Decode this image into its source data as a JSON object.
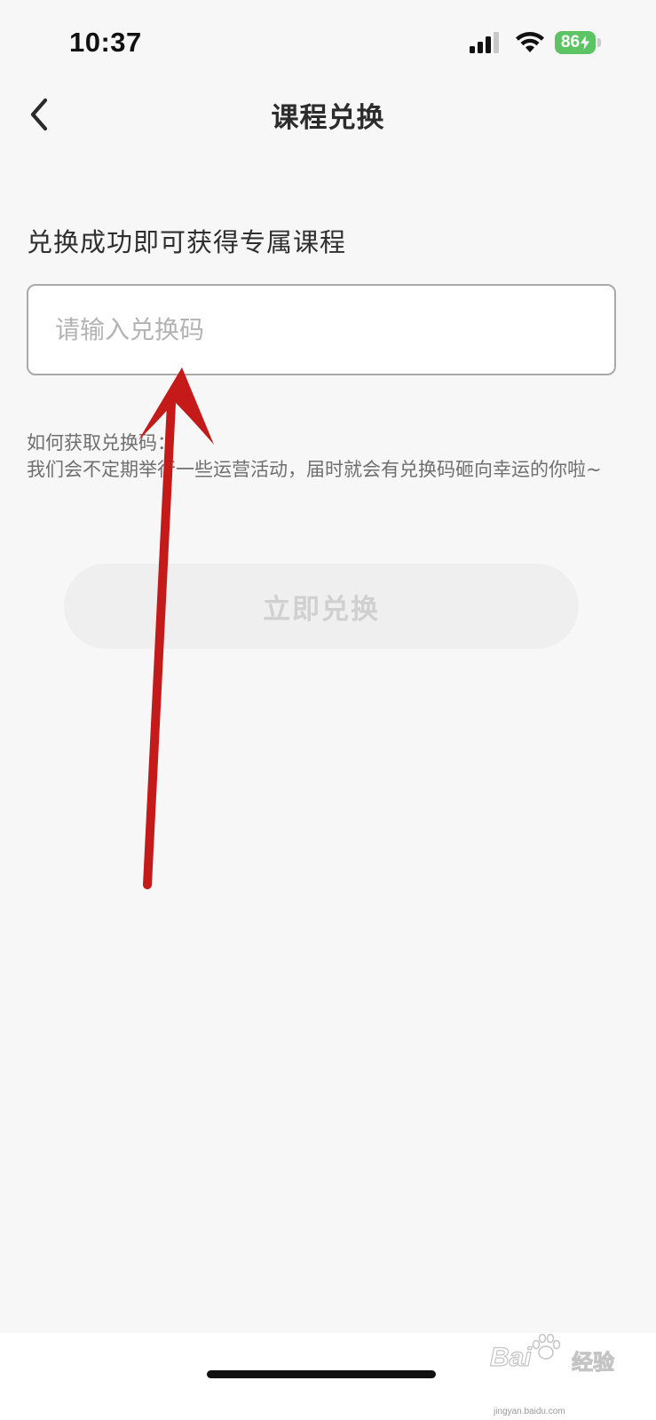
{
  "status_bar": {
    "time": "10:37",
    "battery_level": "86",
    "battery_color": "#5dc466",
    "icons": [
      "signal-icon",
      "wifi-icon",
      "battery-icon"
    ]
  },
  "nav": {
    "back_icon": "chevron-left-icon",
    "title": "课程兑换"
  },
  "redeem": {
    "section_title": "兑换成功即可获得专属课程",
    "input_placeholder": "请输入兑换码",
    "input_value": "",
    "help_title": "如何获取兑换码：",
    "help_text": "我们会不定期举行一些运营活动，届时就会有兑换码砸向幸运的你啦~",
    "button_label": "立即兑换",
    "button_enabled": false
  },
  "annotation": {
    "arrow_color": "#c41a1a"
  },
  "watermark": {
    "brand": "Bai",
    "brand_text": "经验",
    "url": "jingyan.baidu.com"
  }
}
